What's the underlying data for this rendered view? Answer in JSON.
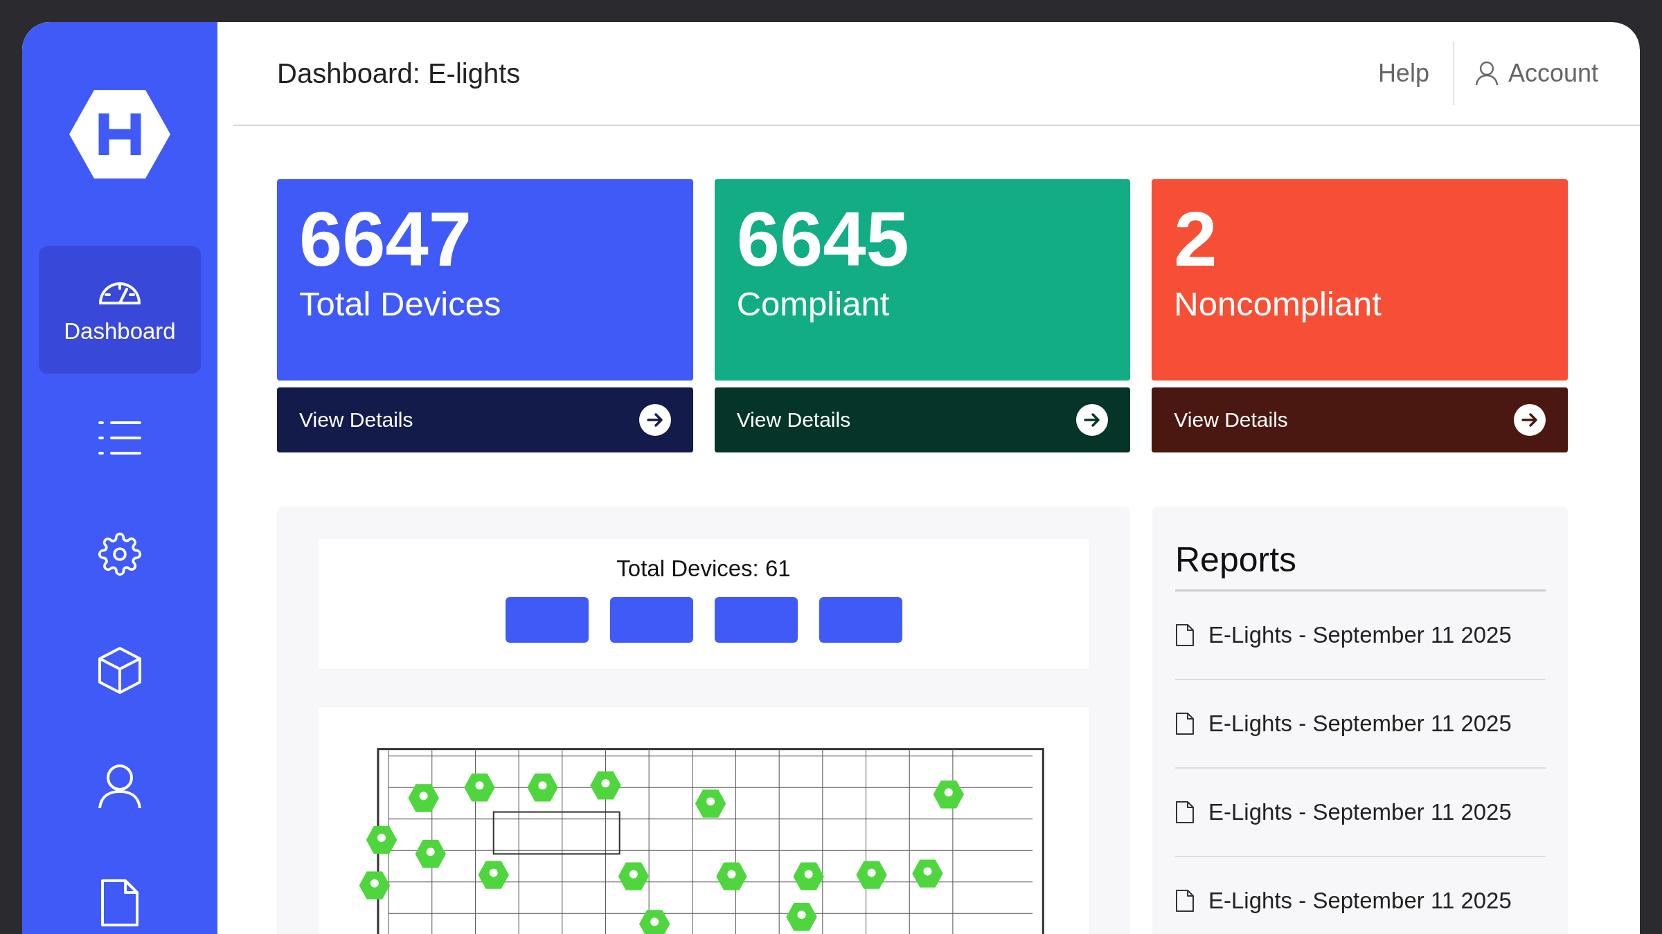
{
  "sidebar": {
    "items": [
      {
        "label": "Dashboard",
        "selected": true
      },
      {
        "selected": false
      },
      {
        "selected": false
      },
      {
        "selected": false
      },
      {
        "selected": false
      },
      {
        "selected": false
      }
    ]
  },
  "header": {
    "title": "Dashboard: E-lights",
    "help": "Help",
    "account": "Account"
  },
  "stats": [
    {
      "value": "6647",
      "label": "Total Devices",
      "color": "#3f5af7",
      "action": "View Details"
    },
    {
      "value": "6645",
      "label": "Compliant",
      "color": "#12ad84",
      "action": "View Details"
    },
    {
      "value": "2",
      "label": "Noncompliant",
      "color": "#f64f36",
      "action": "View Details"
    }
  ],
  "devices_panel": {
    "title": "Total Devices: 61",
    "filter_buttons": [
      {
        "kind": "blank"
      },
      {
        "kind": "blank"
      },
      {
        "kind": "blank"
      },
      {
        "kind": "blank"
      }
    ]
  },
  "reports": {
    "title": "Reports",
    "items": [
      "E-Lights - September 11 2025",
      "E-Lights - September 11 2025",
      "E-Lights - September 11 2025",
      "E-Lights - September 11 2025"
    ]
  }
}
